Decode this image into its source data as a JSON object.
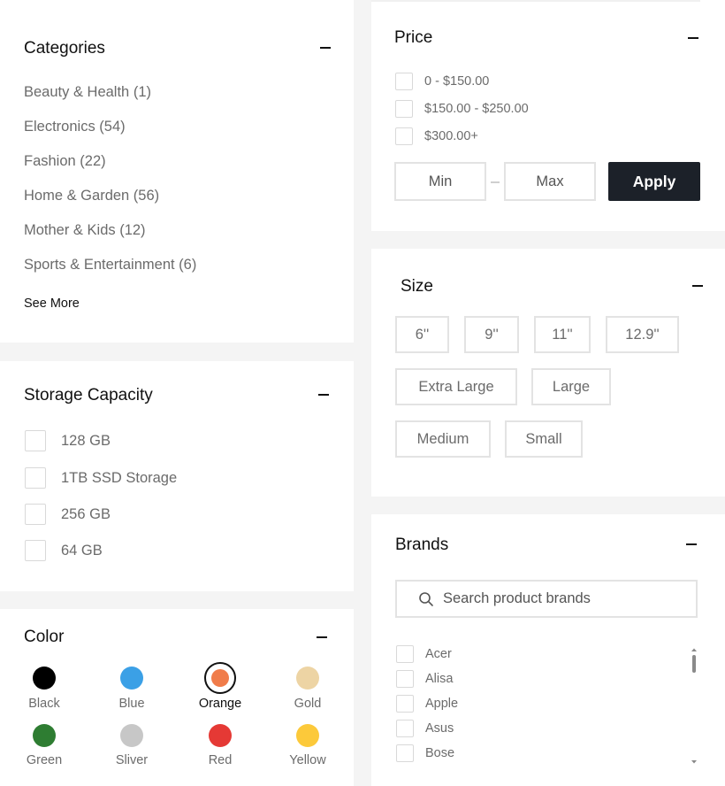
{
  "categories": {
    "title": "Categories",
    "items": [
      {
        "label": "Beauty & Health (1)"
      },
      {
        "label": "Electronics (54)"
      },
      {
        "label": "Fashion (22)"
      },
      {
        "label": "Home & Garden (56)"
      },
      {
        "label": "Mother & Kids (12)"
      },
      {
        "label": "Sports & Entertainment (6)"
      }
    ],
    "see_more": "See More"
  },
  "storage": {
    "title": "Storage Capacity",
    "options": [
      {
        "label": "128 GB"
      },
      {
        "label": "1TB SSD Storage"
      },
      {
        "label": "256 GB"
      },
      {
        "label": "64 GB"
      }
    ]
  },
  "color": {
    "title": "Color",
    "swatches": [
      {
        "label": "Black",
        "hex": "#000000",
        "selected": false
      },
      {
        "label": "Blue",
        "hex": "#3ba0e6",
        "selected": false
      },
      {
        "label": "Orange",
        "hex": "#f07c4a",
        "selected": true
      },
      {
        "label": "Gold",
        "hex": "#edd4a4",
        "selected": false
      },
      {
        "label": "Green",
        "hex": "#2e7d32",
        "selected": false
      },
      {
        "label": "Sliver",
        "hex": "#c7c7c7",
        "selected": false
      },
      {
        "label": "Red",
        "hex": "#e53935",
        "selected": false
      },
      {
        "label": "Yellow",
        "hex": "#fcc93a",
        "selected": false
      }
    ]
  },
  "price": {
    "title": "Price",
    "ranges": [
      {
        "label": "0 - $150.00"
      },
      {
        "label": "$150.00 - $250.00"
      },
      {
        "label": "$300.00+"
      }
    ],
    "min_placeholder": "Min",
    "max_placeholder": "Max",
    "apply_label": "Apply"
  },
  "size": {
    "title": "Size",
    "options": [
      "6''",
      "9''",
      "11''",
      "12.9''",
      "Extra Large",
      "Large",
      "Medium",
      "Small"
    ]
  },
  "brands": {
    "title": "Brands",
    "search_placeholder": "Search product brands",
    "items": [
      {
        "label": "Acer"
      },
      {
        "label": "Alisa"
      },
      {
        "label": "Apple"
      },
      {
        "label": "Asus"
      },
      {
        "label": "Bose"
      }
    ]
  },
  "colors": {
    "apply_bg": "#1c2129",
    "border": "#e3e3e3",
    "muted_text": "#6b6b6b"
  }
}
